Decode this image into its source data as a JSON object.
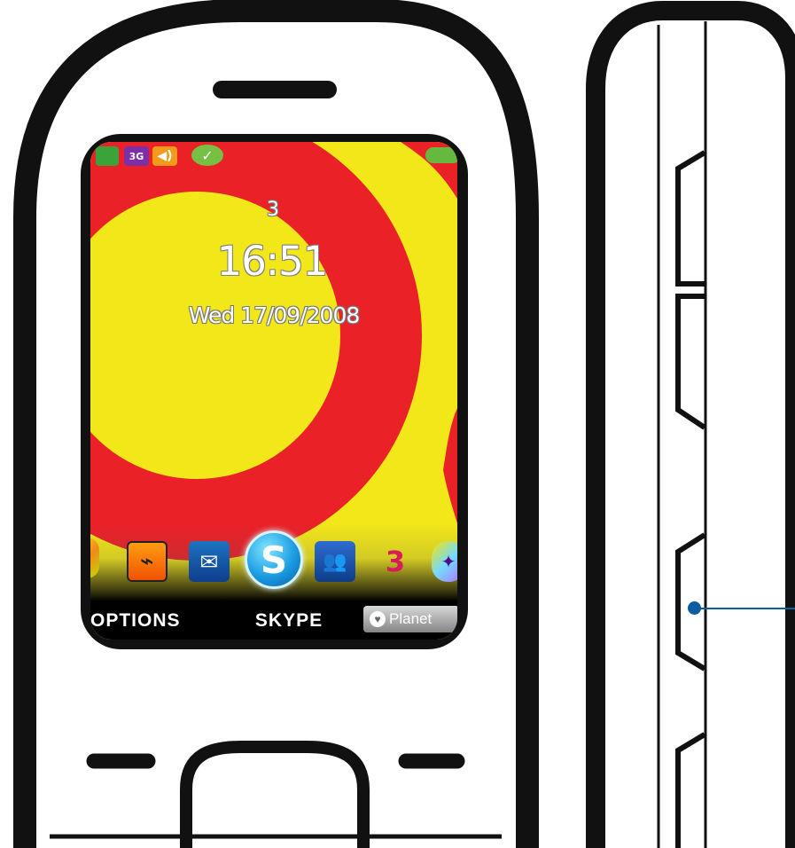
{
  "screen": {
    "operator": "3",
    "time": "16:51",
    "date": "Wed  17/09/2008",
    "status_icons": [
      {
        "name": "signal-icon",
        "text": ""
      },
      {
        "name": "network-3g-icon",
        "text": "3G"
      },
      {
        "name": "volume-icon",
        "text": "◀)"
      },
      {
        "name": "messenger-status-icon",
        "text": "✓"
      },
      {
        "name": "battery-icon",
        "text": ""
      }
    ],
    "dock_apps": [
      {
        "name": "app-left-edge-icon",
        "symbol": ""
      },
      {
        "name": "rss-app-icon",
        "symbol": "⌁"
      },
      {
        "name": "mail-app-icon",
        "symbol": "✉"
      },
      {
        "name": "skype-app-icon",
        "symbol": "S"
      },
      {
        "name": "community-app-icon",
        "symbol": "👥"
      },
      {
        "name": "three-app-icon",
        "symbol": "3"
      },
      {
        "name": "app-right-edge-icon",
        "symbol": "✦"
      }
    ],
    "softkeys": {
      "left": "OPTIONS",
      "center": "SKYPE",
      "right": "Planet"
    }
  },
  "colors": {
    "outline": "#111111",
    "screen_yellow": "#f2e719",
    "screen_red": "#eb2128",
    "callout_blue": "#0b5d9e"
  }
}
